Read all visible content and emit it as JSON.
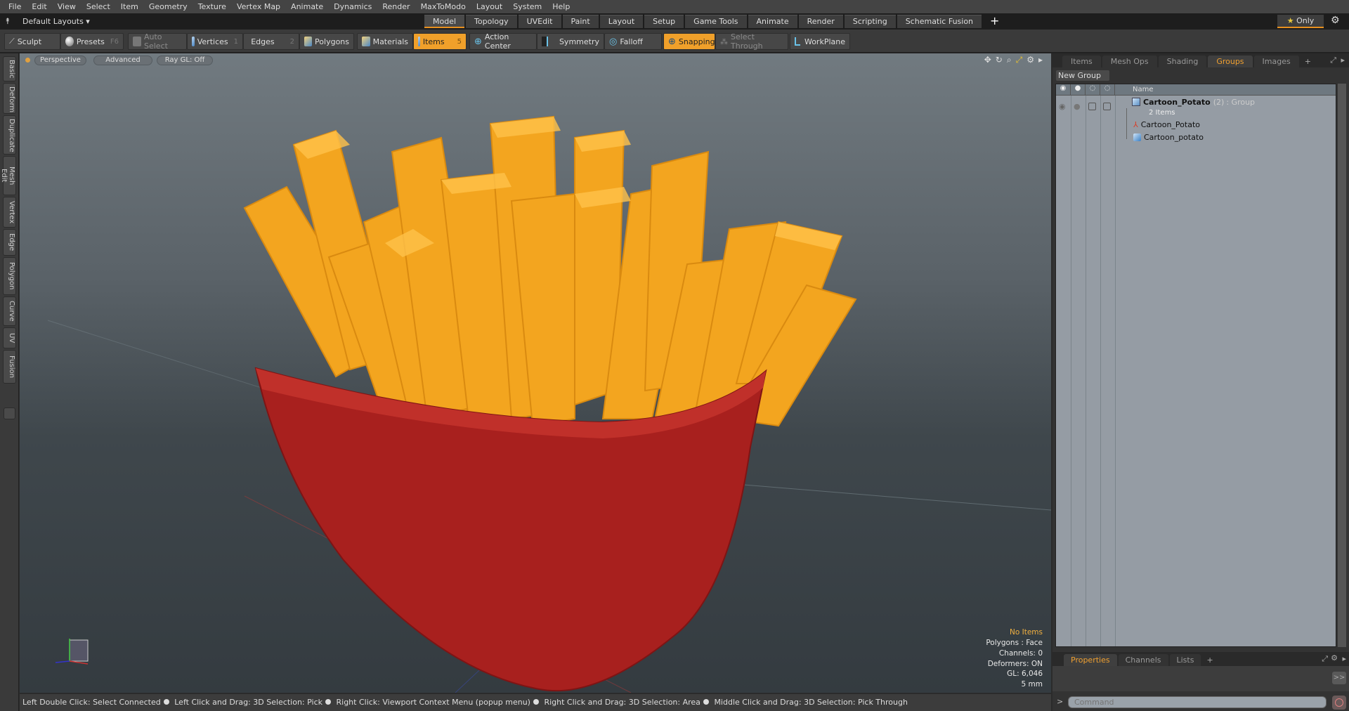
{
  "menubar": {
    "items": [
      "File",
      "Edit",
      "View",
      "Select",
      "Item",
      "Geometry",
      "Texture",
      "Vertex Map",
      "Animate",
      "Dynamics",
      "Render",
      "MaxToModo",
      "Layout",
      "System",
      "Help"
    ]
  },
  "layoutbar": {
    "layout_selector": "Default Layouts ▾",
    "tabs": [
      {
        "label": "Model",
        "active": true
      },
      {
        "label": "Topology"
      },
      {
        "label": "UVEdit"
      },
      {
        "label": "Paint"
      },
      {
        "label": "Layout"
      },
      {
        "label": "Setup"
      },
      {
        "label": "Game Tools"
      },
      {
        "label": "Animate"
      },
      {
        "label": "Render"
      },
      {
        "label": "Scripting"
      },
      {
        "label": "Schematic Fusion"
      }
    ],
    "add_tab": "+",
    "only_label": "Only",
    "accent_color": "#e8901e"
  },
  "toolbar": {
    "sculpt": "Sculpt",
    "presets": "Presets",
    "presets_hotkey": "F6",
    "auto_select": "Auto Select",
    "vertices": "Vertices",
    "vertices_hotkey": "1",
    "edges": "Edges",
    "edges_hotkey": "2",
    "polygons": "Polygons",
    "materials": "Materials",
    "items": "Items",
    "items_hotkey": "5",
    "action_center": "Action Center",
    "symmetry": "Symmetry",
    "falloff": "Falloff",
    "snapping": "Snapping",
    "select_through": "Select Through",
    "workplane": "WorkPlane"
  },
  "leftbar": {
    "tabs": [
      "Basic",
      "Deform",
      "Duplicate",
      "Mesh Edit",
      "Vertex",
      "Edge",
      "Polygon",
      "Curve",
      "UV",
      "Fusion"
    ]
  },
  "viewport": {
    "view_mode": "Perspective",
    "shading": "Advanced",
    "raygl": "Ray GL: Off",
    "info": {
      "selection": "No Items",
      "polygons": "Polygons : Face",
      "channels": "Channels: 0",
      "deformers": "Deformers: ON",
      "gl": "GL: 6,046",
      "unit": "5 mm"
    }
  },
  "statusbar": {
    "hints": [
      "Left Double Click: Select Connected",
      "Left Click and Drag: 3D Selection: Pick",
      "Right Click: Viewport Context Menu (popup menu)",
      "Right Click and Drag: 3D Selection: Area",
      "Middle Click and Drag: 3D Selection: Pick Through"
    ]
  },
  "rightpanel": {
    "tabs": [
      {
        "label": "Items"
      },
      {
        "label": "Mesh Ops"
      },
      {
        "label": "Shading"
      },
      {
        "label": "Groups",
        "active": true
      },
      {
        "label": "Images"
      }
    ],
    "new_group": "New Group",
    "list_header": "Name",
    "group": {
      "name": "Cartoon_Potato",
      "count": "(2)",
      "type": ": Group",
      "subtitle": "2 Items",
      "children": [
        "Cartoon_Potato",
        "Cartoon_potato"
      ]
    },
    "bottom_tabs": [
      {
        "label": "Properties",
        "active": true
      },
      {
        "label": "Channels"
      },
      {
        "label": "Lists"
      }
    ],
    "expand": ">>",
    "command_placeholder": "Command",
    "command_prompt": ">"
  }
}
